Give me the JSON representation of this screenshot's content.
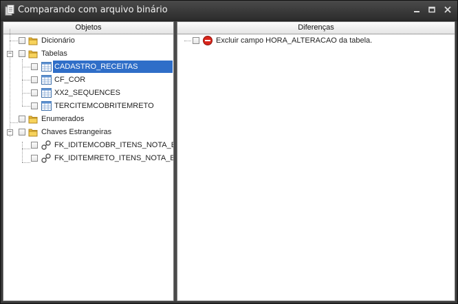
{
  "window": {
    "title": "Comparando com arquivo binário"
  },
  "left_pane": {
    "header": "Objetos",
    "items": [
      {
        "label": "Dicionário"
      },
      {
        "label": "Tabelas"
      },
      {
        "label": "CADASTRO_RECEITAS"
      },
      {
        "label": "CF_COR"
      },
      {
        "label": "XX2_SEQUENCES"
      },
      {
        "label": "TERCITEMCOBRITEMRETO"
      },
      {
        "label": "Enumerados"
      },
      {
        "label": "Chaves Estrangeiras"
      },
      {
        "label": "FK_IDITEMCOBR_ITENS_NOTA_ENT"
      },
      {
        "label": "FK_IDITEMRETO_ITENS_NOTA_ENT"
      }
    ]
  },
  "right_pane": {
    "header": "Diferenças",
    "items": [
      {
        "label": "Excluir campo HORA_ALTERACAO da tabela."
      }
    ]
  }
}
